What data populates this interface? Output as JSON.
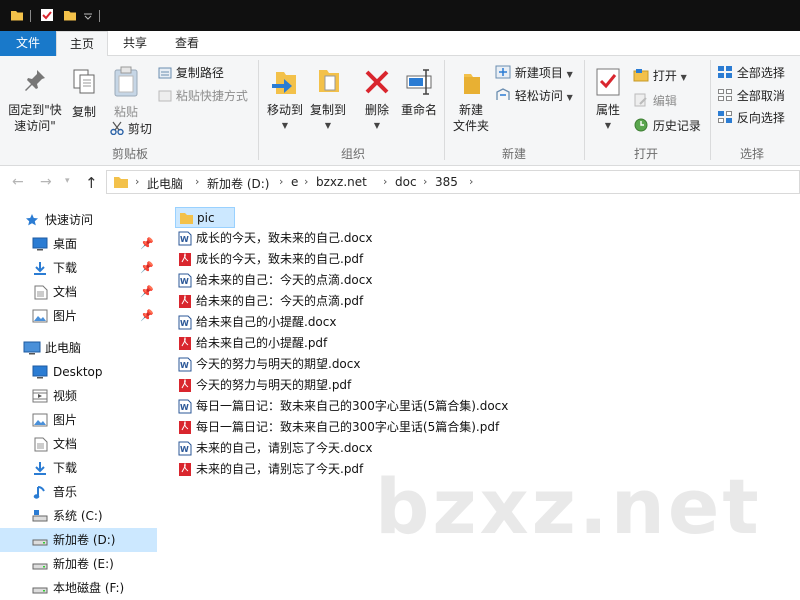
{
  "tabs": {
    "file": "文件",
    "home": "主页",
    "share": "共享",
    "view": "查看"
  },
  "ribbon": {
    "clipboard": {
      "pin_line1": "固定到\"快",
      "pin_line2": "速访问\"",
      "copy": "复制",
      "paste": "粘贴",
      "copy_path": "复制路径",
      "paste_shortcut": "粘贴快捷方式",
      "cut": "剪切",
      "label": "剪贴板"
    },
    "organize": {
      "move_to": "移动到",
      "copy_to": "复制到",
      "delete": "删除",
      "rename": "重命名",
      "label": "组织"
    },
    "new": {
      "new_folder_line1": "新建",
      "new_folder_line2": "文件夹",
      "new_item": "新建项目",
      "easy_access": "轻松访问",
      "label": "新建"
    },
    "open": {
      "properties": "属性",
      "open": "打开",
      "edit": "编辑",
      "history": "历史记录",
      "label": "打开"
    },
    "select": {
      "select_all": "全部选择",
      "select_none": "全部取消",
      "invert": "反向选择",
      "label": "选择"
    }
  },
  "address": {
    "crumbs": [
      "此电脑",
      "新加卷 (D:)",
      "e",
      "bzxz.net",
      "doc",
      "385"
    ]
  },
  "sidebar": {
    "items": [
      {
        "label": "快速访问",
        "icon": "star-icon"
      },
      {
        "label": "桌面",
        "icon": "desktop-icon",
        "pinned": true
      },
      {
        "label": "下载",
        "icon": "download-icon",
        "pinned": true
      },
      {
        "label": "文档",
        "icon": "document-icon",
        "pinned": true
      },
      {
        "label": "图片",
        "icon": "picture-icon",
        "pinned": true
      },
      {
        "label": "此电脑",
        "icon": "computer-icon"
      },
      {
        "label": "Desktop",
        "icon": "desktop-icon"
      },
      {
        "label": "视频",
        "icon": "video-icon"
      },
      {
        "label": "图片",
        "icon": "picture-icon"
      },
      {
        "label": "文档",
        "icon": "document-icon"
      },
      {
        "label": "下载",
        "icon": "download-icon"
      },
      {
        "label": "音乐",
        "icon": "music-icon"
      },
      {
        "label": "系统 (C:)",
        "icon": "system-drive-icon"
      },
      {
        "label": "新加卷 (D:)",
        "icon": "drive-icon",
        "selected": true
      },
      {
        "label": "新加卷 (E:)",
        "icon": "drive-icon"
      },
      {
        "label": "本地磁盘 (F:)",
        "icon": "drive-icon"
      }
    ]
  },
  "files": [
    {
      "name": "pic",
      "type": "folder"
    },
    {
      "name": "成长的今天，致未来的自己.docx",
      "type": "docx"
    },
    {
      "name": "成长的今天，致未来的自己.pdf",
      "type": "pdf"
    },
    {
      "name": "给未来的自己：今天的点滴.docx",
      "type": "docx"
    },
    {
      "name": "给未来的自己：今天的点滴.pdf",
      "type": "pdf"
    },
    {
      "name": "给未来自己的小提醒.docx",
      "type": "docx"
    },
    {
      "name": "给未来自己的小提醒.pdf",
      "type": "pdf"
    },
    {
      "name": "今天的努力与明天的期望.docx",
      "type": "docx"
    },
    {
      "name": "今天的努力与明天的期望.pdf",
      "type": "pdf"
    },
    {
      "name": "每日一篇日记：致未来自己的300字心里话(5篇合集).docx",
      "type": "docx"
    },
    {
      "name": "每日一篇日记：致未来自己的300字心里话(5篇合集).pdf",
      "type": "pdf"
    },
    {
      "name": "未来的自己，请别忘了今天.docx",
      "type": "docx"
    },
    {
      "name": "未来的自己，请别忘了今天.pdf",
      "type": "pdf"
    }
  ],
  "watermark": "bzxz.net",
  "colors": {
    "accent": "#1979ca",
    "selection": "#cce8ff",
    "folder": "#f3c14a",
    "pdf": "#d9262e",
    "word": "#2b5797"
  }
}
